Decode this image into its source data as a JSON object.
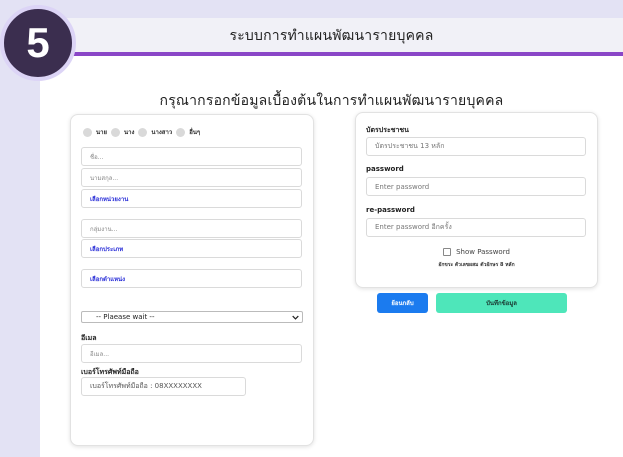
{
  "badge": {
    "number": "5"
  },
  "header": {
    "title": "ระบบการทำแผนพัฒนารายบุคคล"
  },
  "form": {
    "title": "กรุณากรอกข้อมูลเบื้องต้นในการทำแผนพัฒนารายบุคคล",
    "left": {
      "prefix_options": [
        "นาย",
        "นาง",
        "นางสาว",
        "อื่นๆ"
      ],
      "first_name_placeholder": "ชื่อ...",
      "last_name_placeholder": "นามสกุล...",
      "agency_select": "เลือกหน่วยงาน",
      "group_placeholder": "กลุ่มงาน...",
      "type_select": "เลือกประเภท",
      "position_select": "เลือกตำแหน่ง",
      "dropdown_value": "-- Plaease wait --",
      "email_label": "อีเมล",
      "email_placeholder": "อีเมล...",
      "phone_label": "เบอร์โทรศัพท์มือถือ",
      "phone_placeholder": "เบอร์โทรศัพท์มือถือ : 08XXXXXXXX"
    },
    "right": {
      "id_label": "บัตรประชาชน",
      "id_placeholder": "บัตรประชาชน 13 หลัก",
      "password_label": "password",
      "password_placeholder": "Enter password",
      "repassword_label": "re-password",
      "repassword_placeholder": "Enter password อีกครั้ง",
      "show_password": "Show Password",
      "hint": "อักขระ ตัวเลขผสม ตัวอักษร 8 หลัก"
    },
    "buttons": {
      "back": "ย้อนกลับ",
      "save": "บันทึกข้อมูล"
    }
  },
  "colors": {
    "accent": "#8a46c7",
    "badge": "#3b2e4f",
    "back_button": "#1b7bef",
    "save_button": "#4ee6ba"
  }
}
